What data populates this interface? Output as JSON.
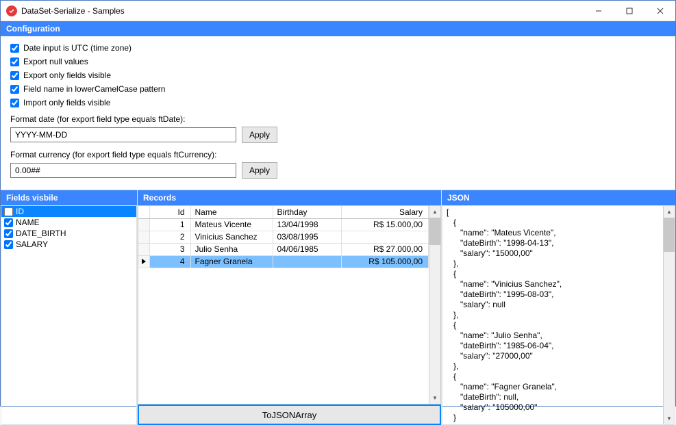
{
  "window": {
    "title": "DataSet-Serialize - Samples"
  },
  "sections": {
    "config": "Configuration",
    "fields": "Fields visbile",
    "records": "Records",
    "json": "JSON"
  },
  "config": {
    "checks": [
      {
        "label": "Date input is UTC (time zone)",
        "checked": true
      },
      {
        "label": "Export null values",
        "checked": true
      },
      {
        "label": "Export only fields visible",
        "checked": true
      },
      {
        "label": "Field name in lowerCamelCase pattern",
        "checked": true
      },
      {
        "label": "Import only fields visible",
        "checked": true
      }
    ],
    "format_date_label": "Format date (for export field type equals ftDate):",
    "format_date_value": "YYYY-MM-DD",
    "format_currency_label": "Format currency (for export field type equals ftCurrency):",
    "format_currency_value": "0.00##",
    "apply_label": "Apply"
  },
  "fields": {
    "items": [
      {
        "label": "ID",
        "checked": false,
        "selected": true
      },
      {
        "label": "NAME",
        "checked": true,
        "selected": false
      },
      {
        "label": "DATE_BIRTH",
        "checked": true,
        "selected": false
      },
      {
        "label": "SALARY",
        "checked": true,
        "selected": false
      }
    ]
  },
  "records": {
    "columns": {
      "id": "Id",
      "name": "Name",
      "birthday": "Birthday",
      "salary": "Salary"
    },
    "rows": [
      {
        "id": "1",
        "name": "Mateus Vicente",
        "birthday": "13/04/1998",
        "salary": "R$ 15.000,00",
        "selected": false
      },
      {
        "id": "2",
        "name": "Vinicius Sanchez",
        "birthday": "03/08/1995",
        "salary": "",
        "selected": false
      },
      {
        "id": "3",
        "name": "Julio Senha",
        "birthday": "04/06/1985",
        "salary": "R$ 27.000,00",
        "selected": false
      },
      {
        "id": "4",
        "name": "Fagner Granela",
        "birthday": "",
        "salary": "R$ 105.000,00",
        "selected": true
      }
    ],
    "to_json_label": "ToJSONArray"
  },
  "json": {
    "text": "[\n   {\n      \"name\": \"Mateus Vicente\",\n      \"dateBirth\": \"1998-04-13\",\n      \"salary\": \"15000,00\"\n   },\n   {\n      \"name\": \"Vinicius Sanchez\",\n      \"dateBirth\": \"1995-08-03\",\n      \"salary\": null\n   },\n   {\n      \"name\": \"Julio Senha\",\n      \"dateBirth\": \"1985-06-04\",\n      \"salary\": \"27000,00\"\n   },\n   {\n      \"name\": \"Fagner Granela\",\n      \"dateBirth\": null,\n      \"salary\": \"105000,00\"\n   }"
  }
}
